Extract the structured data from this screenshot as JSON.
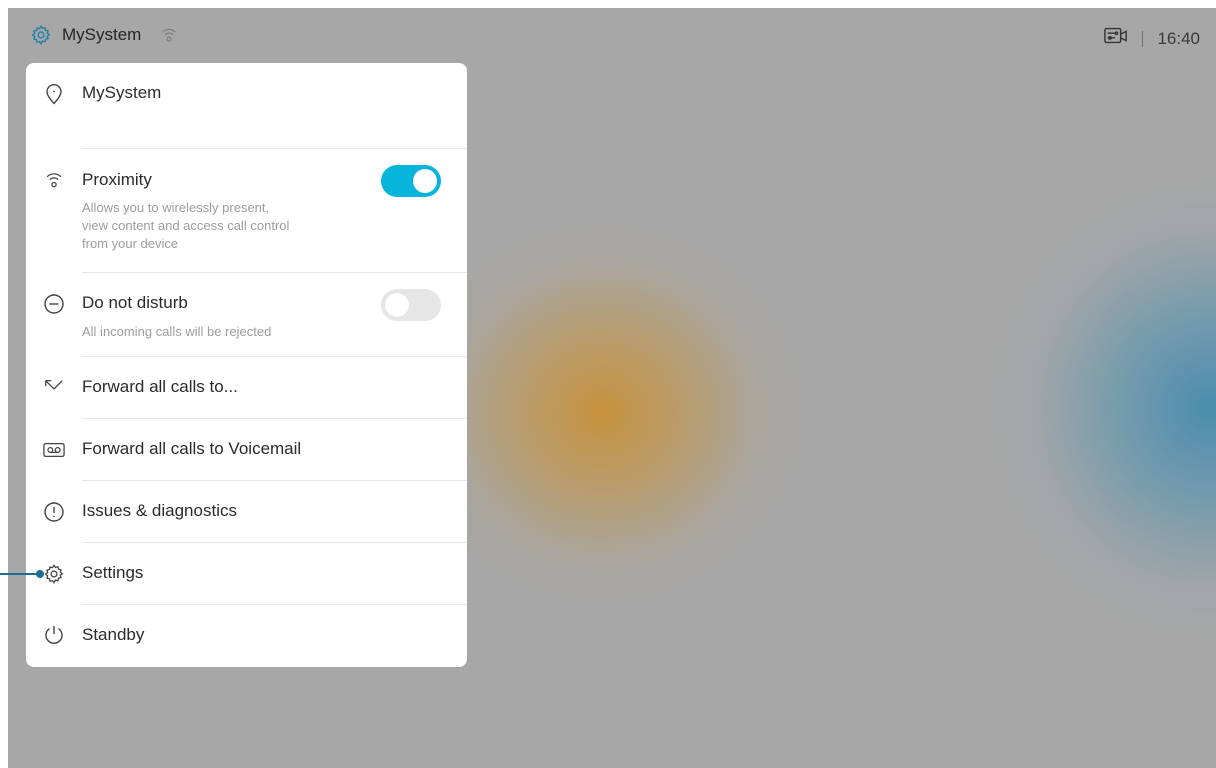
{
  "topbar": {
    "system_name": "MySystem",
    "time": "16:40"
  },
  "menu": {
    "location": {
      "label": "MySystem"
    },
    "proximity": {
      "label": "Proximity",
      "description": [
        "Allows you to wirelessly present,",
        "view content and access call control",
        "from your device"
      ],
      "enabled": true
    },
    "dnd": {
      "label": "Do not disturb",
      "description": "All incoming calls will be rejected",
      "enabled": false
    },
    "forward": {
      "label": "Forward all calls to..."
    },
    "voicemail": {
      "label": "Forward all calls to Voicemail"
    },
    "issues": {
      "label": "Issues & diagnostics"
    },
    "settings": {
      "label": "Settings"
    },
    "standby": {
      "label": "Standby"
    }
  },
  "colors": {
    "accent": "#07b5dc",
    "background": "#a7a7a7",
    "callout": "#1a6f97",
    "brand_icon": "#1e7fa8"
  },
  "icons": {
    "brand": "gear-icon",
    "status_wifi": "proximity-icon",
    "camera": "camera-control-icon"
  }
}
